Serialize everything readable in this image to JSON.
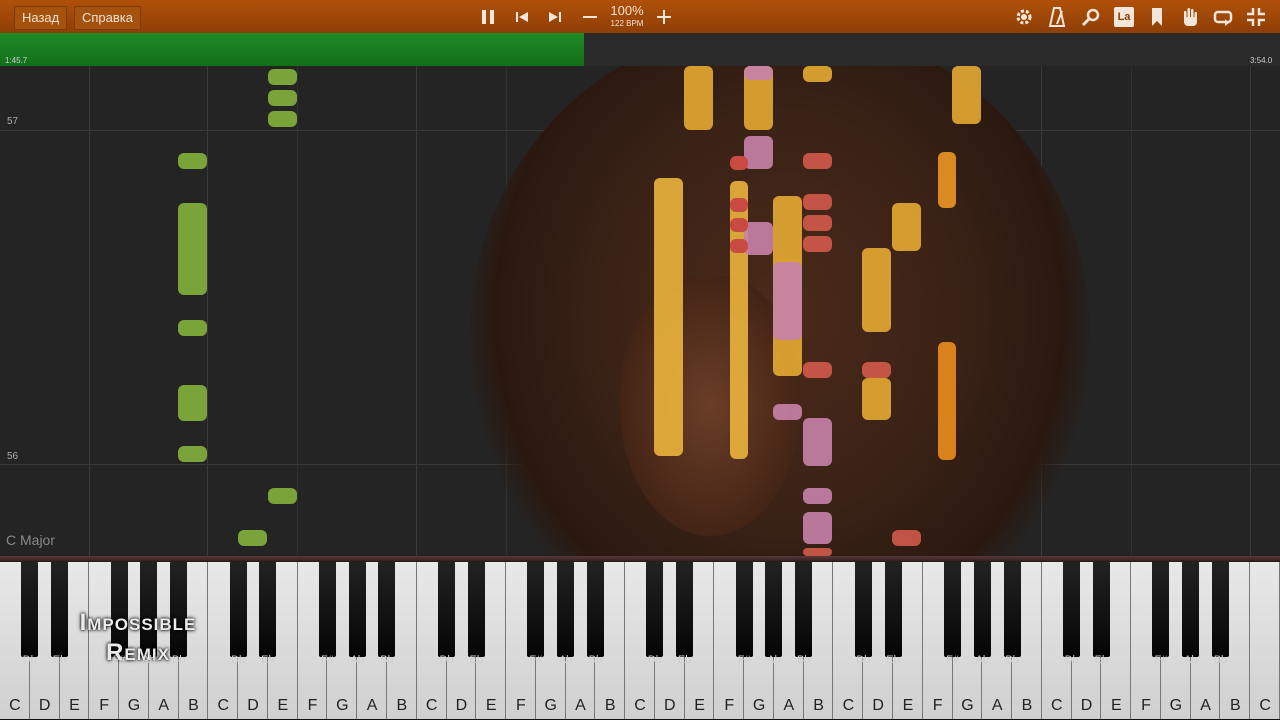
{
  "menu": {
    "back": "Назад",
    "help": "Справка"
  },
  "playback": {
    "zoom": "100%",
    "bpm": "122 BPM"
  },
  "timeline": {
    "elapsed": "1:45.7",
    "total": "3:54.0",
    "progress": 0.456
  },
  "measures": [
    "57",
    "56"
  ],
  "key_signature": "C Major",
  "toolbar_icons": [
    "gear-icon",
    "metronome-icon",
    "search-icon",
    "label-icon",
    "bookmark-icon",
    "hand-icon",
    "loop-icon",
    "exit-fullscreen-icon"
  ],
  "label_button": "La",
  "watermark": {
    "line1": "Impossible",
    "line2": "Remix"
  },
  "keyboard": {
    "white_keys": [
      "C",
      "D",
      "E",
      "F",
      "G",
      "A",
      "B",
      "C",
      "D",
      "E",
      "F",
      "G",
      "A",
      "B",
      "C",
      "D",
      "E",
      "F",
      "G",
      "A",
      "B",
      "C",
      "D",
      "E",
      "F",
      "G",
      "A",
      "B",
      "C",
      "D",
      "E",
      "F",
      "G",
      "A",
      "B",
      "C",
      "D",
      "E",
      "F",
      "G",
      "A",
      "B",
      "C"
    ],
    "black_key_labels": [
      "Db",
      "Eb",
      "F#",
      "Ab",
      "Bb",
      "Db",
      "Eb",
      "F#",
      "Ab",
      "Bb",
      "Db",
      "Eb",
      "F#",
      "Ab",
      "Bb",
      "Db",
      "Eb",
      "F#",
      "Ab",
      "Bb",
      "Db",
      "Eb",
      "F#",
      "Ab",
      "Bb",
      "Db",
      "Eb",
      "F#",
      "Ab",
      "Bb"
    ]
  },
  "colors": {
    "accent": "#a54d09",
    "progress": "#1f8a27",
    "green_notes": "#7aa33a",
    "orange_notes": "#e0a030",
    "pink_notes": "#c57aa8",
    "red_notes": "#d0584a"
  }
}
